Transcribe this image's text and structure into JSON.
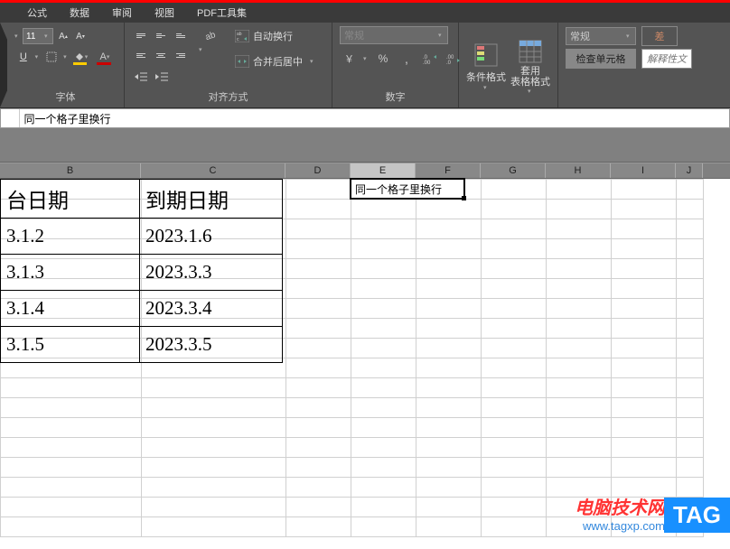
{
  "menu": [
    "公式",
    "数据",
    "审阅",
    "视图",
    "PDF工具集"
  ],
  "ribbon": {
    "font_size": "11",
    "font_group": "字体",
    "align_group": "对齐方式",
    "number_group": "数字",
    "wrap_text": "自动换行",
    "merge_center": "合并后居中",
    "general_dd": "常规",
    "cond_format": "条件格式",
    "table_format": "套用\n表格格式",
    "number_format": "常规",
    "check_cell": "检查单元格",
    "bad_cell": "差",
    "note_cell": "解释性文"
  },
  "formula_bar": {
    "value": "同一个格子里换行"
  },
  "columns": [
    {
      "label": "B",
      "width": 156
    },
    {
      "label": "C",
      "width": 160
    },
    {
      "label": "D",
      "width": 72
    },
    {
      "label": "E",
      "width": 72
    },
    {
      "label": "F",
      "width": 72
    },
    {
      "label": "G",
      "width": 72
    },
    {
      "label": "H",
      "width": 72
    },
    {
      "label": "I",
      "width": 72
    },
    {
      "label": "J",
      "width": 30
    }
  ],
  "table": {
    "headers": [
      "台日期",
      "到期日期"
    ],
    "rows": [
      [
        "3.1.2",
        "2023.1.6"
      ],
      [
        "3.1.3",
        "2023.3.3"
      ],
      [
        "3.1.4",
        "2023.3.4"
      ],
      [
        "3.1.5",
        "2023.3.5"
      ]
    ]
  },
  "active_cell": {
    "value": "同一个格子里换行",
    "col": "E",
    "row": 1
  },
  "watermark": {
    "title": "电脑技术网",
    "url": "www.tagxp.com",
    "tag": "TAG"
  }
}
